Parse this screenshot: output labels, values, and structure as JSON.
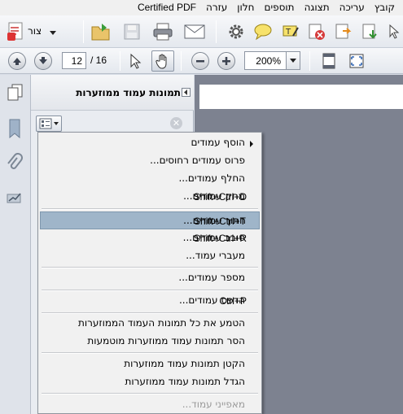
{
  "menubar": {
    "items": [
      "קובץ",
      "עריכה",
      "תצוגה",
      "תוספים",
      "חלון",
      "עזרה",
      "Certified PDF"
    ]
  },
  "toolbar": {
    "create_label": "צור",
    "page_current": "12",
    "page_total": "/ 16",
    "zoom": "200%"
  },
  "panel": {
    "title": "תמונות עמוד ממוזערות"
  },
  "menu": {
    "items": [
      {
        "label": "הוסף עמודים",
        "shortcut": "",
        "submenu": true
      },
      {
        "label": "פרוס עמודים רחוסים...",
        "shortcut": ""
      },
      {
        "label": "החלף עמודים...",
        "shortcut": ""
      },
      {
        "label": "מחק עמודים...",
        "shortcut": "Shift+Ctrl+D"
      },
      {
        "label": "חתוך עמודים...",
        "shortcut": "Shift+Ctrl+T",
        "highlighted": true
      },
      {
        "label": "סובב עמודים...",
        "shortcut": "Shift+Ctrl+R"
      },
      {
        "label": "מעברי עמוד...",
        "shortcut": ""
      },
      {
        "label": "מספר עמודים...",
        "shortcut": ""
      },
      {
        "label": "הדפס עמודים...",
        "shortcut": "Ctrl+P"
      },
      {
        "label": "הטמע את כל תמונות העמוד הממוזערות",
        "shortcut": ""
      },
      {
        "label": "הסר תמונות עמוד ממוזערות מוטמעות",
        "shortcut": ""
      },
      {
        "label": "הקטן תמונות עמוד ממוזערות",
        "shortcut": ""
      },
      {
        "label": "הגדל תמונות עמוד ממוזערות",
        "shortcut": ""
      },
      {
        "label": "מאפייני עמוד...",
        "shortcut": "",
        "disabled": true
      }
    ]
  },
  "colors": {
    "highlight": "#9fb5c9",
    "document_background": "#7d8290"
  }
}
